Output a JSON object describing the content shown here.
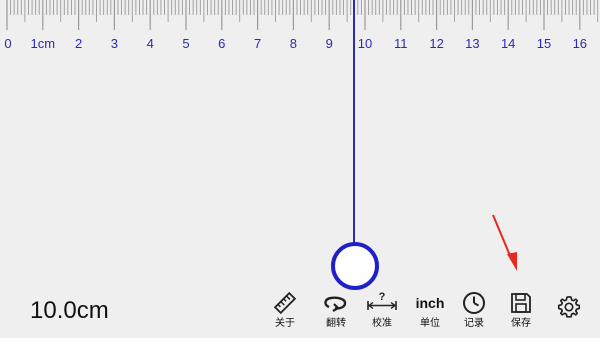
{
  "ruler": {
    "unit": "cm",
    "labels": [
      "0",
      "1cm",
      "2",
      "3",
      "4",
      "5",
      "6",
      "7",
      "8",
      "9",
      "10",
      "11",
      "12",
      "13",
      "14",
      "15",
      "16"
    ],
    "color": "#2a2ab8"
  },
  "measurement": {
    "position_cm": 10.0,
    "readout": "10.0cm"
  },
  "toolbar": {
    "about_label": "关于",
    "flip_label": "翻转",
    "calibrate_label": "校准",
    "calibrate_mark": "?",
    "unit_label": "单位",
    "unit_value": "inch",
    "history_label": "记录",
    "save_label": "保存"
  },
  "icons": [
    "ruler-icon",
    "flip-icon",
    "calibrate-icon",
    "clock-icon",
    "save-icon",
    "gear-icon",
    "annotation-arrow-icon"
  ],
  "colors": {
    "accent": "#2020c8",
    "annotation": "#e8281e"
  }
}
